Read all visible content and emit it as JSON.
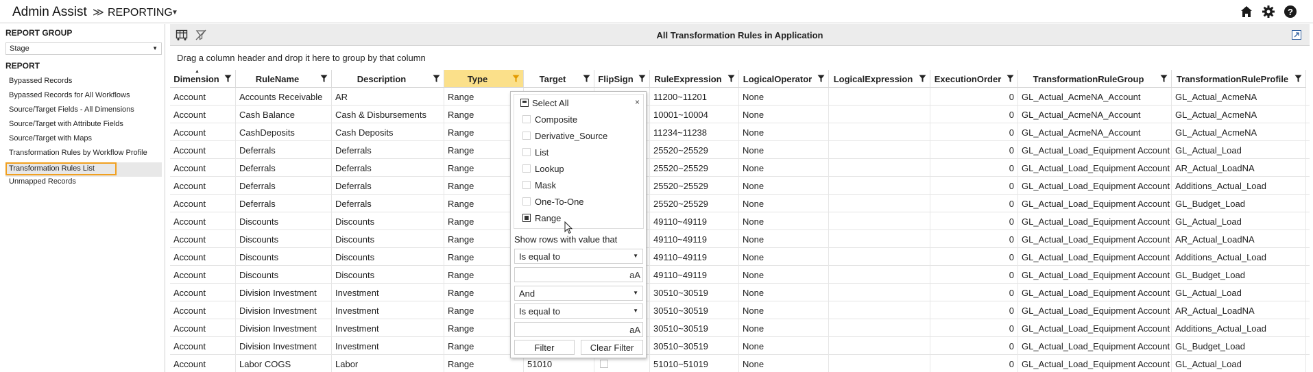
{
  "app": {
    "title": "Admin Assist",
    "breadcrumb_sep": "≫",
    "page": "REPORTING",
    "page_caret": "▼"
  },
  "top_icons": [
    "home-icon",
    "gear-icon",
    "help-icon"
  ],
  "left": {
    "group_heading": "REPORT GROUP",
    "group_value": "Stage",
    "report_heading": "REPORT",
    "items": [
      {
        "label": "Bypassed Records",
        "active": false
      },
      {
        "label": "Bypassed Records for All Workflows",
        "active": false
      },
      {
        "label": "Source/Target Fields - All Dimensions",
        "active": false
      },
      {
        "label": "Source/Target with Attribute Fields",
        "active": false
      },
      {
        "label": "Source/Target with Maps",
        "active": false
      },
      {
        "label": "Transformation Rules by Workflow Profile",
        "active": false
      },
      {
        "label": "Transformation Rules List",
        "active": true
      },
      {
        "label": "Unmapped Records",
        "active": false
      }
    ]
  },
  "main": {
    "title": "All Transformation Rules in Application",
    "group_hint": "Drag a column header and drop it here to group by that column"
  },
  "grid": {
    "columns": [
      {
        "key": "dimension",
        "label": "Dimension"
      },
      {
        "key": "rulename",
        "label": "RuleName"
      },
      {
        "key": "description",
        "label": "Description"
      },
      {
        "key": "type",
        "label": "Type"
      },
      {
        "key": "target",
        "label": "Target"
      },
      {
        "key": "flipsign",
        "label": "FlipSign"
      },
      {
        "key": "ruleexpression",
        "label": "RuleExpression"
      },
      {
        "key": "logicaloperator",
        "label": "LogicalOperator"
      },
      {
        "key": "logicalexpression",
        "label": "LogicalExpression"
      },
      {
        "key": "executionorder",
        "label": "ExecutionOrder"
      },
      {
        "key": "group",
        "label": "TransformationRuleGroup"
      },
      {
        "key": "profile",
        "label": "TransformationRuleProfile"
      }
    ],
    "rows": [
      [
        "Account",
        "Accounts Receivable",
        "AR",
        "Range",
        "",
        "",
        "11200~11201",
        "None",
        "",
        "0",
        "GL_Actual_AcmeNA_Account",
        "GL_Actual_AcmeNA"
      ],
      [
        "Account",
        "Cash Balance",
        "Cash & Disbursements",
        "Range",
        "",
        "",
        "10001~10004",
        "None",
        "",
        "0",
        "GL_Actual_AcmeNA_Account",
        "GL_Actual_AcmeNA"
      ],
      [
        "Account",
        "CashDeposits",
        "Cash Deposits",
        "Range",
        "",
        "",
        "11234~11238",
        "None",
        "",
        "0",
        "GL_Actual_AcmeNA_Account",
        "GL_Actual_AcmeNA"
      ],
      [
        "Account",
        "Deferrals",
        "Deferrals",
        "Range",
        "",
        "",
        "25520~25529",
        "None",
        "",
        "0",
        "GL_Actual_Load_Equipment Account",
        "GL_Actual_Load"
      ],
      [
        "Account",
        "Deferrals",
        "Deferrals",
        "Range",
        "",
        "",
        "25520~25529",
        "None",
        "",
        "0",
        "GL_Actual_Load_Equipment Account",
        "AR_Actual_LoadNA"
      ],
      [
        "Account",
        "Deferrals",
        "Deferrals",
        "Range",
        "",
        "",
        "25520~25529",
        "None",
        "",
        "0",
        "GL_Actual_Load_Equipment Account",
        "Additions_Actual_Load"
      ],
      [
        "Account",
        "Deferrals",
        "Deferrals",
        "Range",
        "",
        "",
        "25520~25529",
        "None",
        "",
        "0",
        "GL_Actual_Load_Equipment Account",
        "GL_Budget_Load"
      ],
      [
        "Account",
        "Discounts",
        "Discounts",
        "Range",
        "",
        "",
        "49110~49119",
        "None",
        "",
        "0",
        "GL_Actual_Load_Equipment Account",
        "GL_Actual_Load"
      ],
      [
        "Account",
        "Discounts",
        "Discounts",
        "Range",
        "",
        "",
        "49110~49119",
        "None",
        "",
        "0",
        "GL_Actual_Load_Equipment Account",
        "AR_Actual_LoadNA"
      ],
      [
        "Account",
        "Discounts",
        "Discounts",
        "Range",
        "",
        "",
        "49110~49119",
        "None",
        "",
        "0",
        "GL_Actual_Load_Equipment Account",
        "Additions_Actual_Load"
      ],
      [
        "Account",
        "Discounts",
        "Discounts",
        "Range",
        "",
        "",
        "49110~49119",
        "None",
        "",
        "0",
        "GL_Actual_Load_Equipment Account",
        "GL_Budget_Load"
      ],
      [
        "Account",
        "Division Investment",
        "Investment",
        "Range",
        "",
        "",
        "30510~30519",
        "None",
        "",
        "0",
        "GL_Actual_Load_Equipment Account",
        "GL_Actual_Load"
      ],
      [
        "Account",
        "Division Investment",
        "Investment",
        "Range",
        "",
        "",
        "30510~30519",
        "None",
        "",
        "0",
        "GL_Actual_Load_Equipment Account",
        "AR_Actual_LoadNA"
      ],
      [
        "Account",
        "Division Investment",
        "Investment",
        "Range",
        "",
        "",
        "30510~30519",
        "None",
        "",
        "0",
        "GL_Actual_Load_Equipment Account",
        "Additions_Actual_Load"
      ],
      [
        "Account",
        "Division Investment",
        "Investment",
        "Range",
        "",
        "",
        "30510~30519",
        "None",
        "",
        "0",
        "GL_Actual_Load_Equipment Account",
        "GL_Budget_Load"
      ],
      [
        "Account",
        "Labor COGS",
        "Labor",
        "Range",
        "51010",
        "",
        "51010~51019",
        "None",
        "",
        "0",
        "GL_Actual_Load_Equipment Account",
        "GL_Actual_Load"
      ]
    ]
  },
  "filter_popup": {
    "select_all": "Select All",
    "close": "×",
    "options": [
      {
        "label": "Composite",
        "checked": false
      },
      {
        "label": "Derivative_Source",
        "checked": false
      },
      {
        "label": "List",
        "checked": false
      },
      {
        "label": "Lookup",
        "checked": false
      },
      {
        "label": "Mask",
        "checked": false
      },
      {
        "label": "One-To-One",
        "checked": false
      },
      {
        "label": "Range",
        "checked": true
      }
    ],
    "caption": "Show rows with value that",
    "operator1": "Is equal to",
    "value1": "",
    "logic": "And",
    "operator2": "Is equal to",
    "value2": "",
    "case_label": "aA",
    "filter_button": "Filter",
    "clear_button": "Clear Filter"
  },
  "colors": {
    "highlight_header": "#fbe08a",
    "active_item_border": "#f0a020"
  }
}
